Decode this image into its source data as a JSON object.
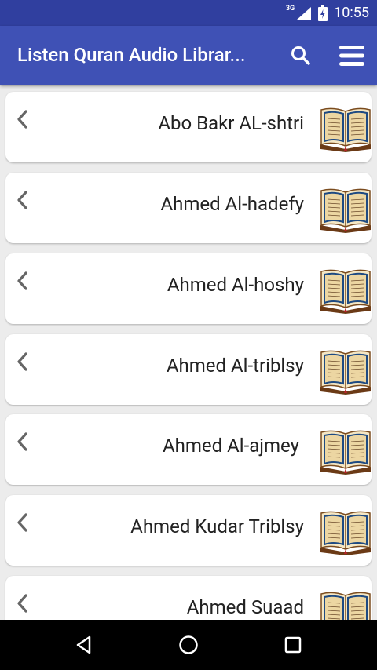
{
  "status_bar": {
    "network": "3G",
    "time": "10:55",
    "icons": [
      "signal-icon",
      "battery-icon"
    ]
  },
  "app_bar": {
    "title": "Listen Quran Audio Librar...",
    "actions": [
      "search-icon",
      "menu-icon"
    ],
    "color": "#3f51b5"
  },
  "list": {
    "items": [
      {
        "name": "Abo Bakr AL-shtri",
        "icon": "quran-book-icon"
      },
      {
        "name": "Ahmed Al-hadefy",
        "icon": "quran-book-icon"
      },
      {
        "name": "Ahmed Al-hoshy",
        "icon": "quran-book-icon"
      },
      {
        "name": "Ahmed Al-triblsy",
        "icon": "quran-book-icon"
      },
      {
        "name": "Ahmed Al-ajmey",
        "icon": "quran-book-icon"
      },
      {
        "name": "Ahmed Kudar Triblsy",
        "icon": "quran-book-icon"
      },
      {
        "name": "Ahmed Suaad",
        "icon": "quran-book-icon"
      }
    ]
  },
  "nav_bar": {
    "buttons": [
      "back-icon",
      "home-icon",
      "recents-icon"
    ]
  }
}
